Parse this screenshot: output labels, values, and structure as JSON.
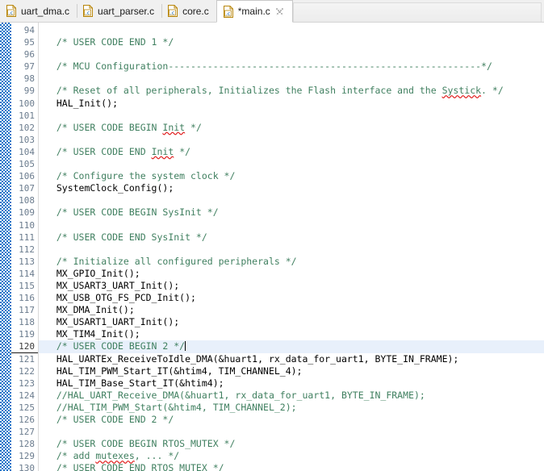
{
  "window": {
    "title": "*main.c",
    "accent_color": "#1e73c8",
    "comment_color": "#3f7f5f",
    "current_line_highlight": "#e8f0fb"
  },
  "tabs": [
    {
      "label": "uart_dma.c",
      "icon": "c-file-icon",
      "active": false,
      "dirty": false,
      "closable": false
    },
    {
      "label": "uart_parser.c",
      "icon": "c-file-icon",
      "active": false,
      "dirty": false,
      "closable": false
    },
    {
      "label": "core.c",
      "icon": "c-file-icon",
      "active": false,
      "dirty": false,
      "closable": false
    },
    {
      "label": "*main.c",
      "icon": "c-file-icon",
      "active": true,
      "dirty": true,
      "closable": true
    }
  ],
  "editor": {
    "first_line": 94,
    "current_line": 120,
    "file_icon_text": ".c",
    "lines": [
      {
        "n": 94,
        "text": ""
      },
      {
        "n": 95,
        "text": "  /* USER CODE END 1 */",
        "kind": "comment"
      },
      {
        "n": 96,
        "text": ""
      },
      {
        "n": 97,
        "text": "  /* MCU Configuration--------------------------------------------------------*/",
        "kind": "comment"
      },
      {
        "n": 98,
        "text": ""
      },
      {
        "n": 99,
        "text": "  /* Reset of all peripherals, Initializes the Flash interface and the Systick. */",
        "kind": "comment",
        "spell": [
          "Systick"
        ]
      },
      {
        "n": 100,
        "text": "  HAL_Init();",
        "kind": "code"
      },
      {
        "n": 101,
        "text": ""
      },
      {
        "n": 102,
        "text": "  /* USER CODE BEGIN Init */",
        "kind": "comment",
        "spell": [
          "Init"
        ]
      },
      {
        "n": 103,
        "text": ""
      },
      {
        "n": 104,
        "text": "  /* USER CODE END Init */",
        "kind": "comment",
        "spell": [
          "Init"
        ]
      },
      {
        "n": 105,
        "text": ""
      },
      {
        "n": 106,
        "text": "  /* Configure the system clock */",
        "kind": "comment"
      },
      {
        "n": 107,
        "text": "  SystemClock_Config();",
        "kind": "code"
      },
      {
        "n": 108,
        "text": ""
      },
      {
        "n": 109,
        "text": "  /* USER CODE BEGIN SysInit */",
        "kind": "comment"
      },
      {
        "n": 110,
        "text": ""
      },
      {
        "n": 111,
        "text": "  /* USER CODE END SysInit */",
        "kind": "comment"
      },
      {
        "n": 112,
        "text": ""
      },
      {
        "n": 113,
        "text": "  /* Initialize all configured peripherals */",
        "kind": "comment"
      },
      {
        "n": 114,
        "text": "  MX_GPIO_Init();",
        "kind": "code"
      },
      {
        "n": 115,
        "text": "  MX_USART3_UART_Init();",
        "kind": "code"
      },
      {
        "n": 116,
        "text": "  MX_USB_OTG_FS_PCD_Init();",
        "kind": "code"
      },
      {
        "n": 117,
        "text": "  MX_DMA_Init();",
        "kind": "code"
      },
      {
        "n": 118,
        "text": "  MX_USART1_UART_Init();",
        "kind": "code"
      },
      {
        "n": 119,
        "text": "  MX_TIM4_Init();",
        "kind": "code"
      },
      {
        "n": 120,
        "text": "  /* USER CODE BEGIN 2 */",
        "kind": "comment",
        "current": true,
        "caret_at_end": true
      },
      {
        "n": 121,
        "text": "  HAL_UARTEx_ReceiveToIdle_DMA(&huart1, rx_data_for_uart1, BYTE_IN_FRAME);",
        "kind": "code"
      },
      {
        "n": 122,
        "text": "  HAL_TIM_PWM_Start_IT(&htim4, TIM_CHANNEL_4);",
        "kind": "code"
      },
      {
        "n": 123,
        "text": "  HAL_TIM_Base_Start_IT(&htim4);",
        "kind": "code"
      },
      {
        "n": 124,
        "text": "  //HAL_UART_Receive_DMA(&huart1, rx_data_for_uart1, BYTE_IN_FRAME);",
        "kind": "comment"
      },
      {
        "n": 125,
        "text": "  //HAL_TIM_PWM_Start(&htim4, TIM_CHANNEL_2);",
        "kind": "comment"
      },
      {
        "n": 126,
        "text": "  /* USER CODE END 2 */",
        "kind": "comment"
      },
      {
        "n": 127,
        "text": ""
      },
      {
        "n": 128,
        "text": "  /* USER CODE BEGIN RTOS_MUTEX */",
        "kind": "comment"
      },
      {
        "n": 129,
        "text": "  /* add mutexes, ... */",
        "kind": "comment",
        "spell": [
          "mutexes"
        ]
      },
      {
        "n": 130,
        "text": "  /* USER CODE END RTOS_MUTEX */",
        "kind": "comment"
      }
    ]
  }
}
